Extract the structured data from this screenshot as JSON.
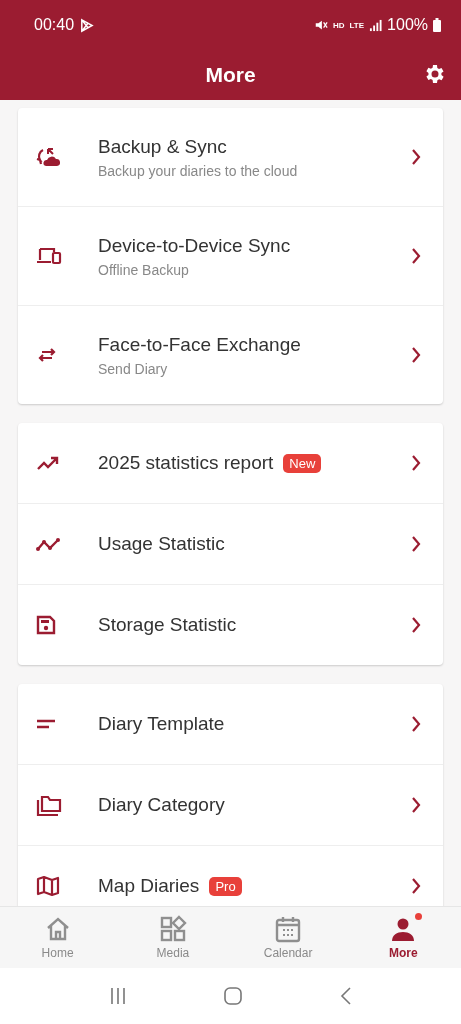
{
  "status_bar": {
    "time": "00:40",
    "network_labels": [
      "HD",
      "LTE"
    ],
    "battery": "100%"
  },
  "app_bar": {
    "title": "More"
  },
  "groups": [
    {
      "rows": [
        {
          "kind": "item",
          "title": "Backup & Sync",
          "subtitle": "Backup your diaries to the cloud"
        },
        {
          "kind": "item",
          "title": "Device-to-Device Sync",
          "subtitle": "Offline Backup"
        },
        {
          "kind": "item",
          "title": "Face-to-Face Exchange",
          "subtitle": "Send Diary"
        }
      ]
    },
    {
      "rows": [
        {
          "kind": "item",
          "title": "2025 statistics report",
          "badge": "New"
        },
        {
          "kind": "item",
          "title": "Usage Statistic"
        },
        {
          "kind": "item",
          "title": "Storage Statistic"
        }
      ]
    },
    {
      "rows": [
        {
          "kind": "item",
          "title": "Diary Template"
        },
        {
          "kind": "item",
          "title": "Diary Category"
        },
        {
          "kind": "item",
          "title": "Map Diaries",
          "badge": "Pro"
        },
        {
          "kind": "blank"
        }
      ]
    }
  ],
  "bottom_nav": [
    {
      "label": "Home",
      "selected": false,
      "dot": false
    },
    {
      "label": "Media",
      "selected": false,
      "dot": false
    },
    {
      "label": "Calendar",
      "selected": false,
      "dot": false
    },
    {
      "label": "More",
      "selected": true,
      "dot": true
    }
  ]
}
